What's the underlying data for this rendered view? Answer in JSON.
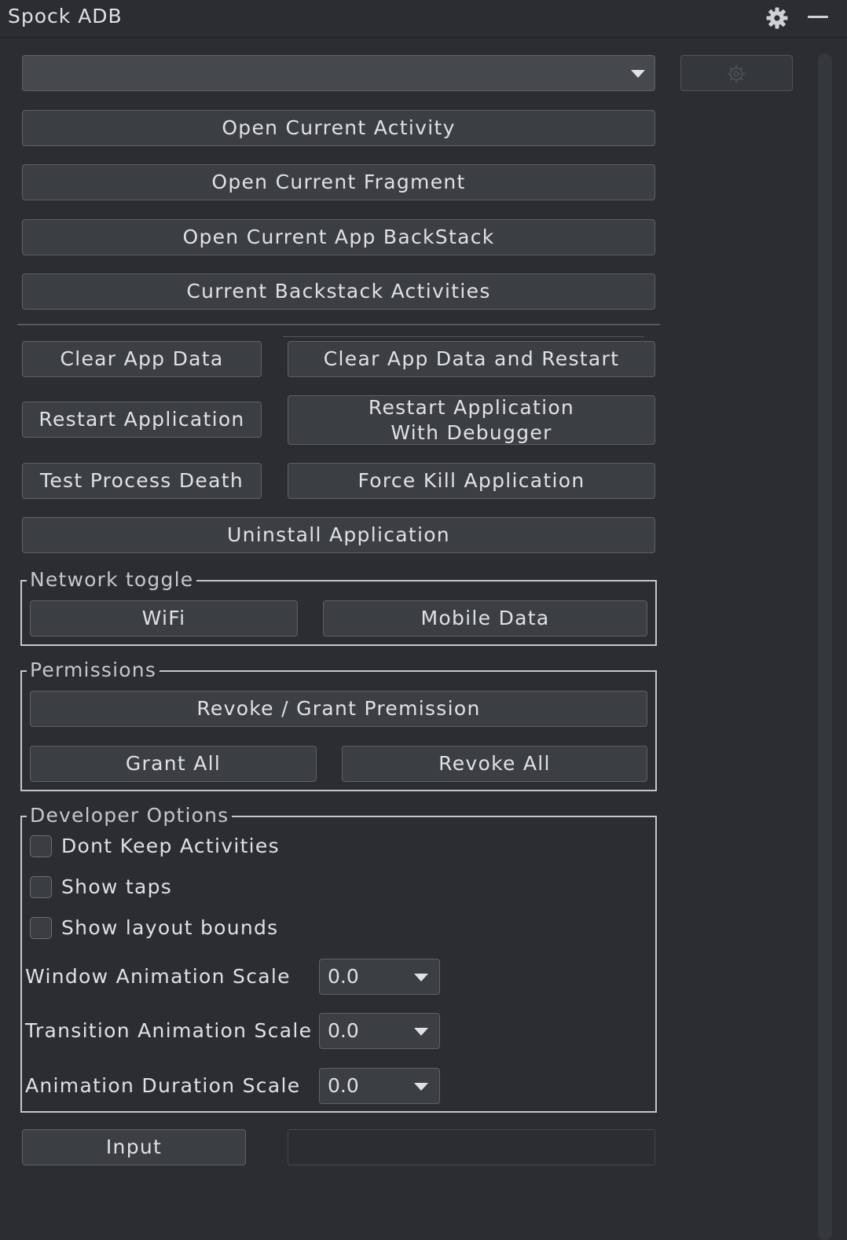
{
  "window": {
    "title": "Spock ADB"
  },
  "device_selector": {
    "selected": ""
  },
  "inspect_buttons": [
    "Open Current Activity",
    "Open Current Fragment",
    "Open Current App BackStack",
    "Current Backstack Activities"
  ],
  "app_actions": {
    "clear_app_data": "Clear App Data",
    "clear_app_data_restart": "Clear App Data and Restart",
    "restart_application": "Restart Application",
    "restart_with_debugger_line1": "Restart Application",
    "restart_with_debugger_line2": "With Debugger",
    "test_process_death": "Test Process Death",
    "force_kill": "Force Kill Application",
    "uninstall": "Uninstall Application"
  },
  "network": {
    "label": "Network toggle",
    "wifi": "WiFi",
    "mobile_data": "Mobile Data"
  },
  "permissions": {
    "label": "Permissions",
    "revoke_grant": "Revoke / Grant Premission",
    "grant_all": "Grant All",
    "revoke_all": "Revoke All"
  },
  "developer_options": {
    "label": "Developer Options",
    "checks": [
      {
        "label": "Dont Keep Activities",
        "checked": false
      },
      {
        "label": "Show taps",
        "checked": false
      },
      {
        "label": "Show layout bounds",
        "checked": false
      }
    ],
    "scales": [
      {
        "label": "Window Animation Scale",
        "value": "0.0"
      },
      {
        "label": "Transition Animation Scale",
        "value": "0.0"
      },
      {
        "label": "Animation Duration Scale",
        "value": "0.0"
      }
    ]
  },
  "input": {
    "button": "Input",
    "value": ""
  }
}
